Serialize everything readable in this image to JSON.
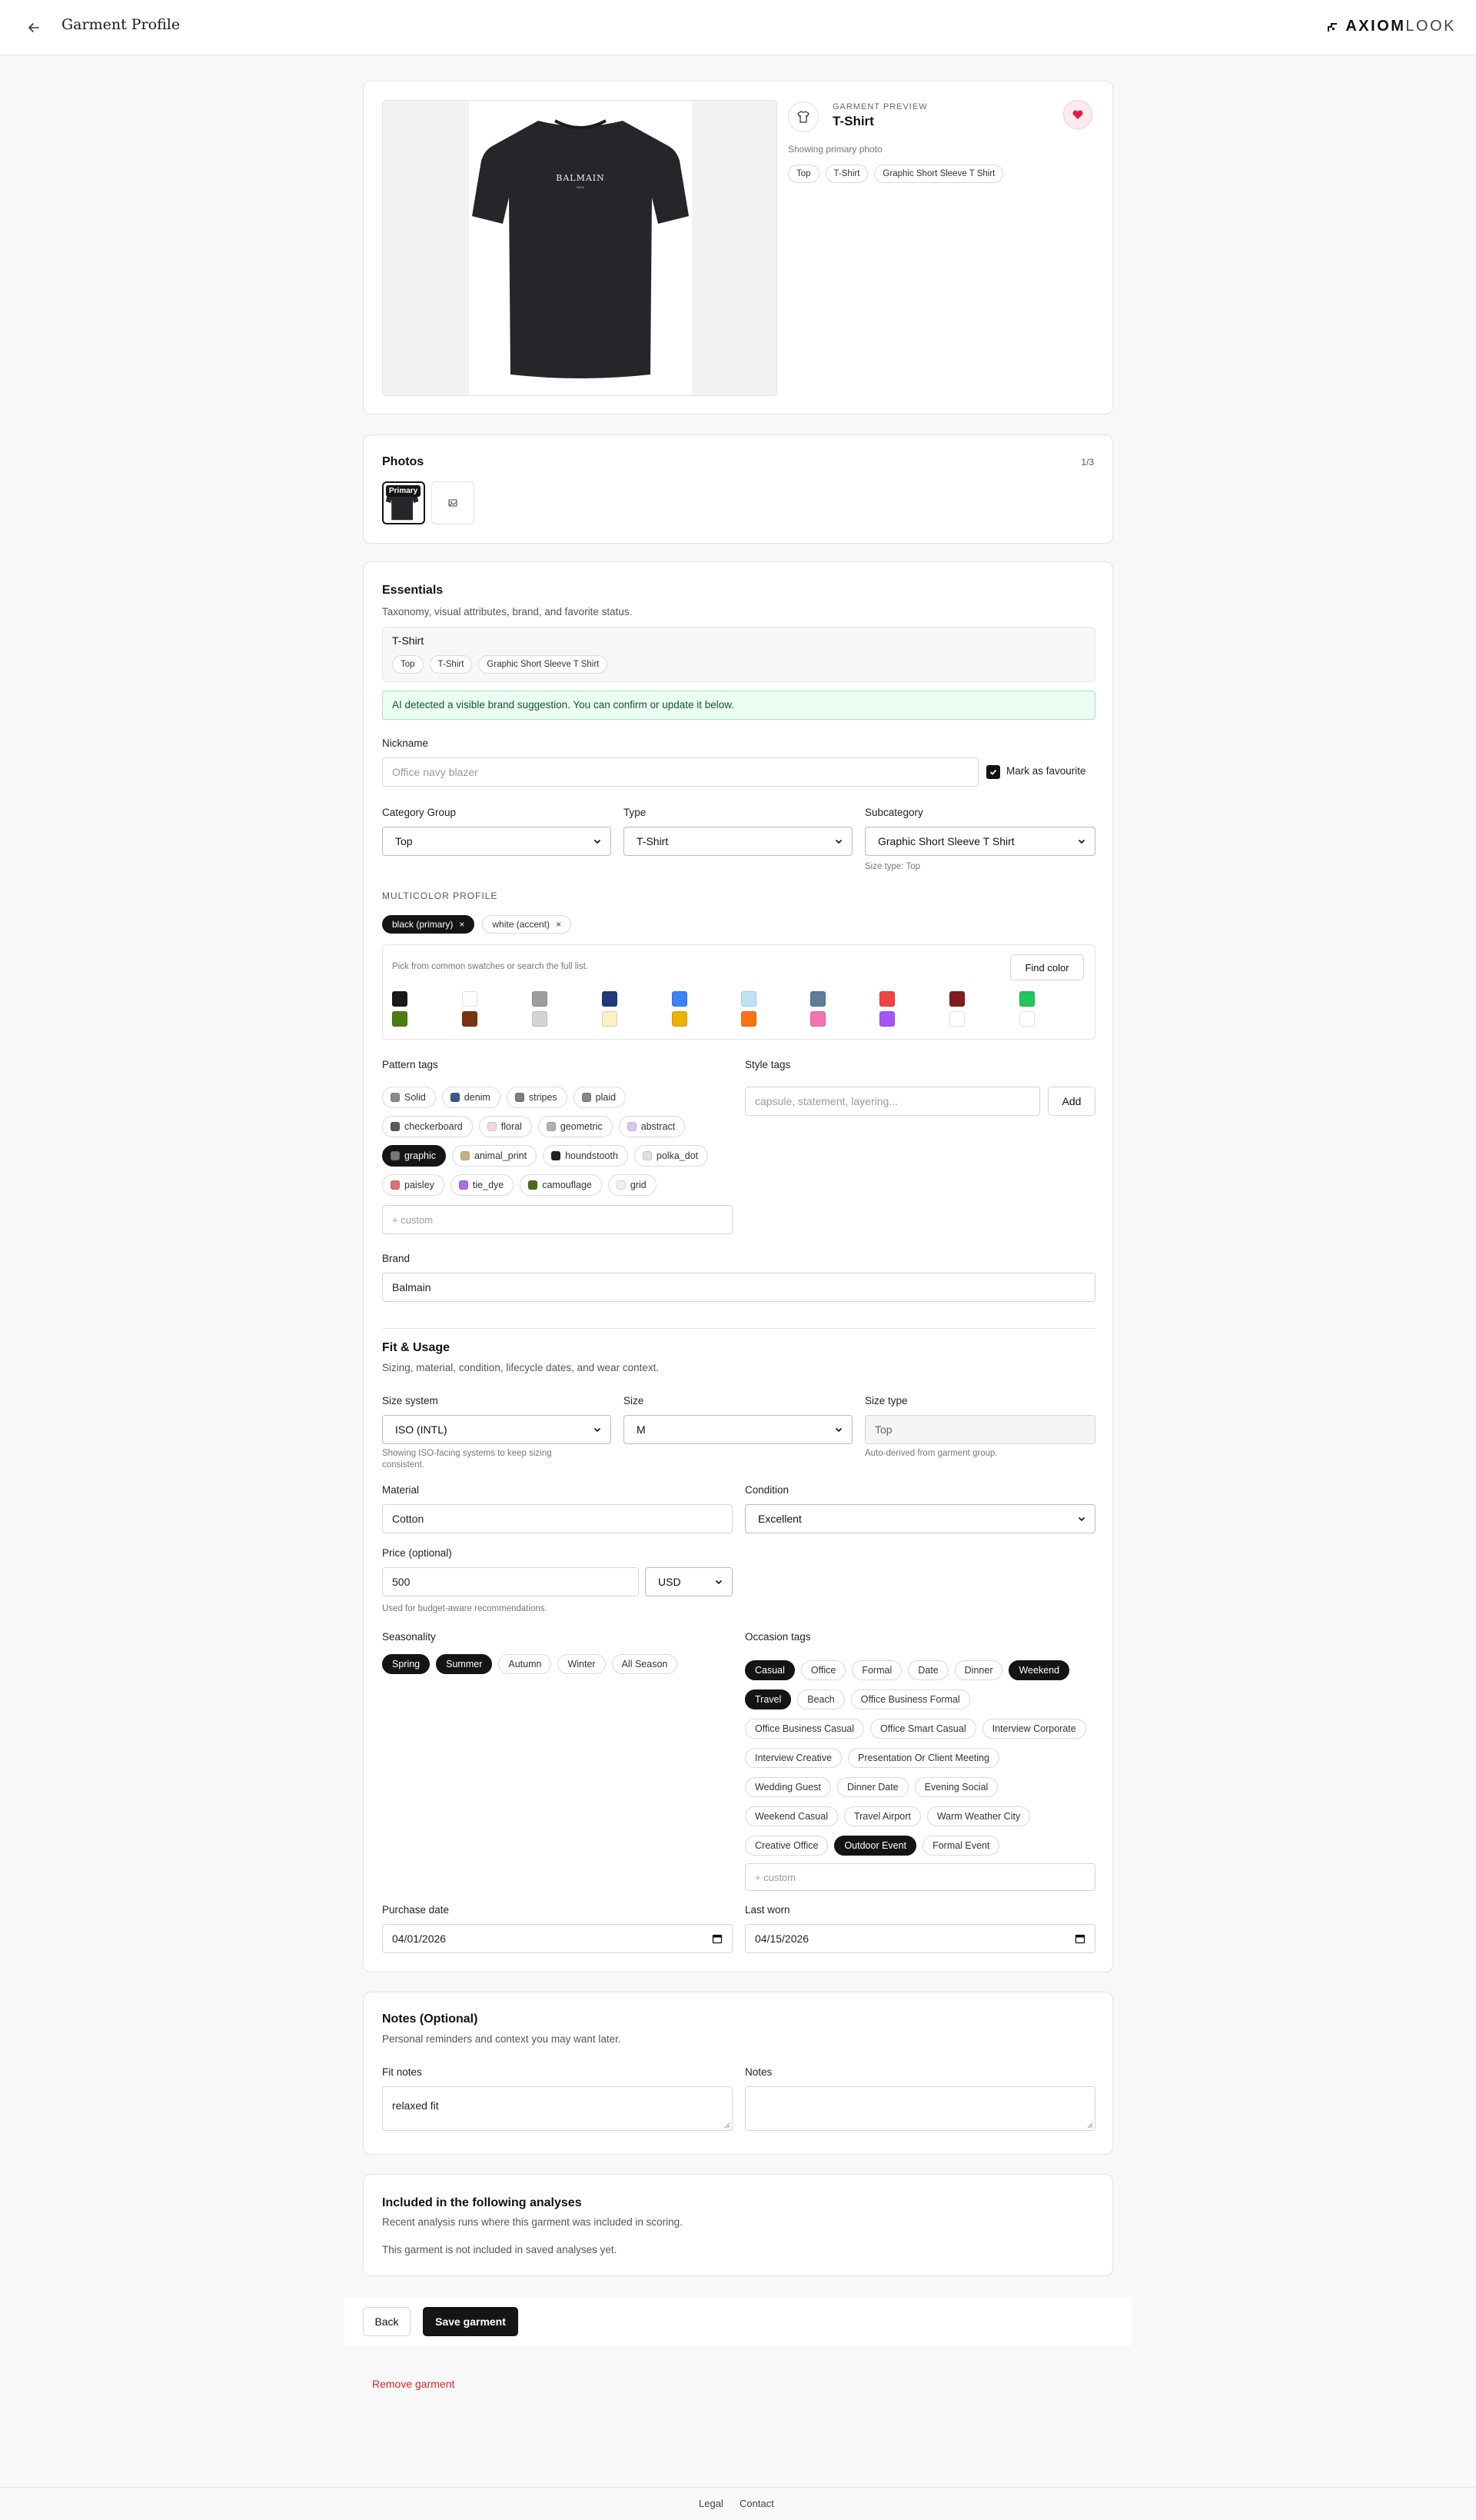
{
  "header": {
    "title": "Garment Profile",
    "logo_bold": "AXIOM",
    "logo_light": "LOOK"
  },
  "preview": {
    "eyebrow": "GARMENT PREVIEW",
    "name": "T-Shirt",
    "caption": "Showing primary photo",
    "tags": [
      "Top",
      "T-Shirt",
      "Graphic Short Sleeve T Shirt"
    ],
    "shirt_brand_print": "BALMAIN",
    "shirt_sub_print": "PARIS"
  },
  "photos": {
    "title": "Photos",
    "count": "1/3",
    "primary_badge": "Primary"
  },
  "essentials": {
    "title": "Essentials",
    "subtitle": "Taxonomy, visual attributes, brand, and favorite status.",
    "summary_name": "T-Shirt",
    "summary_tags": [
      "Top",
      "T-Shirt",
      "Graphic Short Sleeve T Shirt"
    ],
    "ai_notice": "AI detected a visible brand suggestion. You can confirm or update it below.",
    "nickname_label": "Nickname",
    "nickname_placeholder": "Office navy blazer",
    "favourite_label": "Mark as favourite",
    "category_label": "Category Group",
    "category_value": "Top",
    "type_label": "Type",
    "type_value": "T-Shirt",
    "subcategory_label": "Subcategory",
    "subcategory_value": "Graphic Short Sleeve T Shirt",
    "size_type_hint": "Size type: Top",
    "multicolor_label": "MULTICOLOR PROFILE",
    "color_chips": [
      {
        "label": "black (primary)",
        "selected": true
      },
      {
        "label": "white (accent)",
        "selected": false
      }
    ],
    "swatch_hint": "Pick from common swatches or search the full list.",
    "find_color": "Find color",
    "swatch_colors_row1": [
      "#1a1a1a",
      "#ffffff",
      "#9e9e9e",
      "#1f3a7a",
      "#3b82f6",
      "#bde3f7",
      "#5b7d99",
      "#ef4444",
      "#7f1d1d",
      "#22c55e"
    ],
    "swatch_colors_row2": [
      "#4d7c0f",
      "#78350f",
      "#d4d4d4",
      "#fdf0c4",
      "#eab308",
      "#f97316",
      "#f472b6",
      "#a855f7",
      "#ffffff",
      "#ffffff"
    ],
    "pattern_label": "Pattern tags",
    "pattern_rows": [
      [
        {
          "label": "Solid",
          "color": "#8a8a8a",
          "sel": false
        },
        {
          "label": "denim",
          "color": "#3b5a8a",
          "sel": false
        },
        {
          "label": "stripes",
          "color": "#7d7d7d",
          "sel": false
        },
        {
          "label": "plaid",
          "color": "#888888",
          "sel": false
        }
      ],
      [
        {
          "label": "checkerboard",
          "color": "#5a5a5a",
          "sel": false
        },
        {
          "label": "floral",
          "color": "#f0d8d8",
          "sel": false
        },
        {
          "label": "geometric",
          "color": "#b0b0b0",
          "sel": false
        },
        {
          "label": "abstract",
          "color": "#d8c8f0",
          "sel": false
        }
      ],
      [
        {
          "label": "graphic",
          "color": "#777777",
          "sel": true
        },
        {
          "label": "animal_print",
          "color": "#c8b080",
          "sel": false
        },
        {
          "label": "houndstooth",
          "color": "#222222",
          "sel": false
        },
        {
          "label": "polka_dot",
          "color": "#e0e0e0",
          "sel": false
        }
      ],
      [
        {
          "label": "paisley",
          "color": "#e07070",
          "sel": false
        },
        {
          "label": "tie_dye",
          "color": "#b070e0",
          "sel": false
        },
        {
          "label": "camouflage",
          "color": "#4d6b1f",
          "sel": false
        },
        {
          "label": "grid",
          "color": "#f0f0f0",
          "sel": false
        }
      ]
    ],
    "pattern_custom_placeholder": "+ custom",
    "style_label": "Style tags",
    "style_placeholder": "capsule, statement, layering...",
    "style_add": "Add",
    "brand_label": "Brand",
    "brand_value": "Balmain"
  },
  "fit": {
    "title": "Fit & Usage",
    "subtitle": "Sizing, material, condition, lifecycle dates, and wear context.",
    "size_system_label": "Size system",
    "size_system_value": "ISO (INTL)",
    "size_system_hint": "Showing ISO-facing systems to keep sizing consistent.",
    "size_label": "Size",
    "size_value": "M",
    "size_type_label": "Size type",
    "size_type_value": "Top",
    "size_type_hint": "Auto-derived from garment group.",
    "material_label": "Material",
    "material_value": "Cotton",
    "condition_label": "Condition",
    "condition_value": "Excellent",
    "price_label": "Price (optional)",
    "price_value": "500",
    "currency_value": "USD",
    "price_hint": "Used for budget-aware recommendations.",
    "season_label": "Seasonality",
    "seasons": [
      {
        "label": "Spring",
        "sel": true
      },
      {
        "label": "Summer",
        "sel": true
      },
      {
        "label": "Autumn",
        "sel": false
      },
      {
        "label": "Winter",
        "sel": false
      },
      {
        "label": "All Season",
        "sel": false
      }
    ],
    "occasion_label": "Occasion tags",
    "occasion_rows": [
      [
        {
          "label": "Casual",
          "sel": true
        },
        {
          "label": "Office",
          "sel": false
        },
        {
          "label": "Formal",
          "sel": false
        },
        {
          "label": "Date",
          "sel": false
        },
        {
          "label": "Dinner",
          "sel": false
        },
        {
          "label": "Weekend",
          "sel": true
        }
      ],
      [
        {
          "label": "Travel",
          "sel": true
        },
        {
          "label": "Beach",
          "sel": false
        },
        {
          "label": "Office Business Formal",
          "sel": false
        }
      ],
      [
        {
          "label": "Office Business Casual",
          "sel": false
        },
        {
          "label": "Office Smart Casual",
          "sel": false
        },
        {
          "label": "Interview Corporate",
          "sel": false
        }
      ],
      [
        {
          "label": "Interview Creative",
          "sel": false
        },
        {
          "label": "Presentation Or Client Meeting",
          "sel": false
        }
      ],
      [
        {
          "label": "Wedding Guest",
          "sel": false
        },
        {
          "label": "Dinner Date",
          "sel": false
        },
        {
          "label": "Evening Social",
          "sel": false
        }
      ],
      [
        {
          "label": "Weekend Casual",
          "sel": false
        },
        {
          "label": "Travel Airport",
          "sel": false
        },
        {
          "label": "Warm Weather City",
          "sel": false
        }
      ],
      [
        {
          "label": "Creative Office",
          "sel": false
        },
        {
          "label": "Outdoor Event",
          "sel": true
        },
        {
          "label": "Formal Event",
          "sel": false
        }
      ]
    ],
    "occasion_custom_placeholder": "+ custom",
    "purchase_label": "Purchase date",
    "purchase_value": "04/01/2026",
    "lastworn_label": "Last worn",
    "lastworn_value": "04/15/2026"
  },
  "notes": {
    "title": "Notes (Optional)",
    "subtitle": "Personal reminders and context you may want later.",
    "fit_label": "Fit notes",
    "fit_value": "relaxed fit",
    "notes_label": "Notes",
    "notes_value": ""
  },
  "analyses": {
    "title": "Included in the following analyses",
    "subtitle": "Recent analysis runs where this garment was included in scoring.",
    "empty": "This garment is not included in saved analyses yet."
  },
  "actions": {
    "back": "Back",
    "save": "Save garment",
    "remove": "Remove garment"
  },
  "footer": {
    "legal": "Legal",
    "contact": "Contact"
  },
  "colors": {
    "accent_dark": "#141414",
    "favorite_red": "#e11d48",
    "ai_green_bg": "#ecfdf3",
    "danger": "#dc2626"
  }
}
